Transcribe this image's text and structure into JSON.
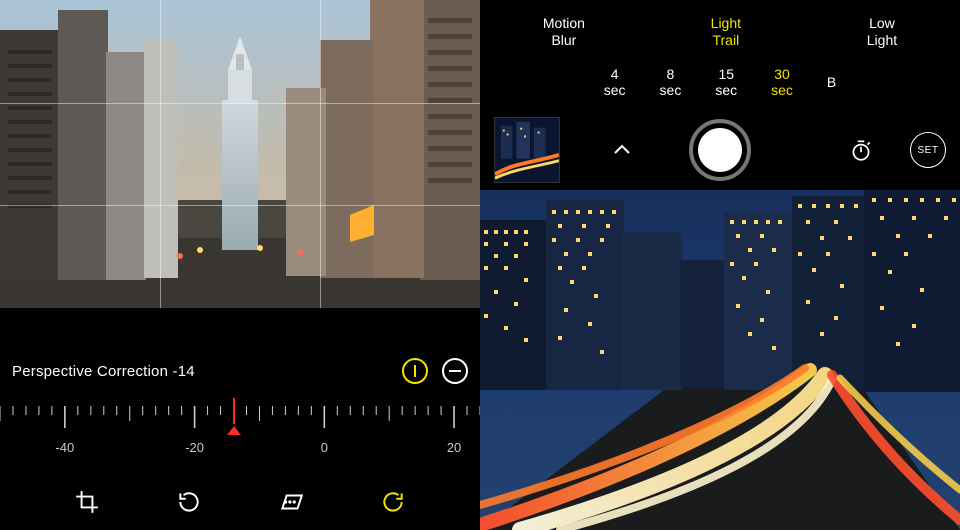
{
  "left_panel": {
    "slider": {
      "label": "Perspective Correction",
      "value": -14,
      "display": "Perspective Correction -14",
      "ticks_major": [
        -40,
        -20,
        0,
        20
      ],
      "range_min": -50,
      "range_max": 24
    },
    "toolbar": {
      "crop_icon": "crop",
      "rotate_icon": "rotate",
      "skew_icon": "skew",
      "reset_icon": "reset"
    },
    "accent_button_icon": "info",
    "secondary_button_icon": "collapse"
  },
  "right_panel": {
    "modes": [
      {
        "line1": "Motion",
        "line2": "Blur",
        "selected": false
      },
      {
        "line1": "Light",
        "line2": "Trail",
        "selected": true
      },
      {
        "line1": "Low",
        "line2": "Light",
        "selected": false
      }
    ],
    "times": [
      {
        "v": "4",
        "u": "sec",
        "selected": false
      },
      {
        "v": "8",
        "u": "sec",
        "selected": false
      },
      {
        "v": "15",
        "u": "sec",
        "selected": false
      },
      {
        "v": "30",
        "u": "sec",
        "selected": true
      },
      {
        "v": "B",
        "u": "",
        "selected": false
      }
    ],
    "set_label": "SET",
    "icons": {
      "last_photo": "thumbnail",
      "chevron": "chevron-up",
      "shutter": "shutter",
      "timer": "self-timer",
      "set": "set"
    }
  },
  "colors": {
    "accent": "#f2e400",
    "needle": "#ff2b2b"
  }
}
